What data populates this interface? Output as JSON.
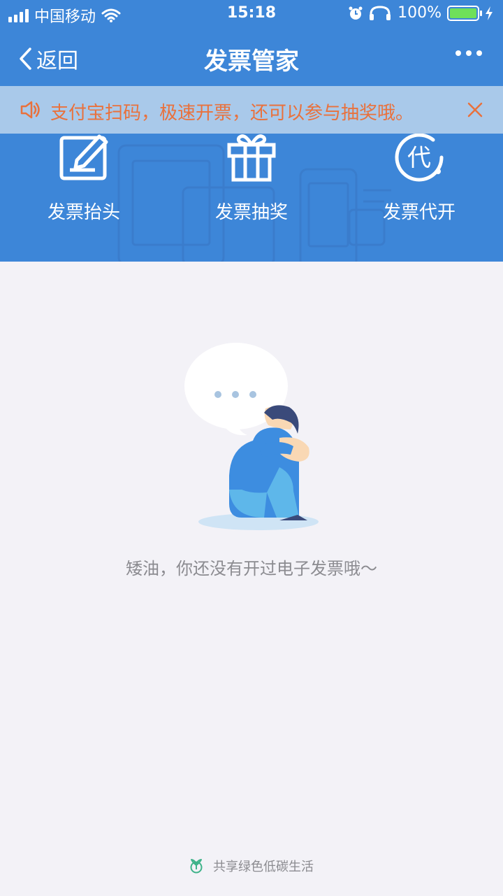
{
  "status_bar": {
    "carrier": "中国移动",
    "time": "15:18",
    "battery": "100%",
    "battery_level": 1.0
  },
  "nav": {
    "back_label": "返回",
    "title": "发票管家"
  },
  "notice": {
    "text": "支付宝扫码，极速开票，还可以参与抽奖哦。"
  },
  "actions": [
    {
      "label": "发票抬头",
      "icon": "edit-note-icon"
    },
    {
      "label": "发票抽奖",
      "icon": "gift-icon"
    },
    {
      "label": "发票代开",
      "icon": "dai-badge-icon",
      "glyph": "代"
    }
  ],
  "empty": {
    "message": "矮油，你还没有开过电子发票哦～",
    "bubble_dots": "• • •"
  },
  "footer": {
    "text": "共享绿色低碳生活"
  },
  "colors": {
    "header_blue": "#3d86d8",
    "notice_bg": "#a9c9ea",
    "notice_text": "#e9713c",
    "page_bg": "#f3f2f7",
    "battery_green": "#6fe05a"
  }
}
